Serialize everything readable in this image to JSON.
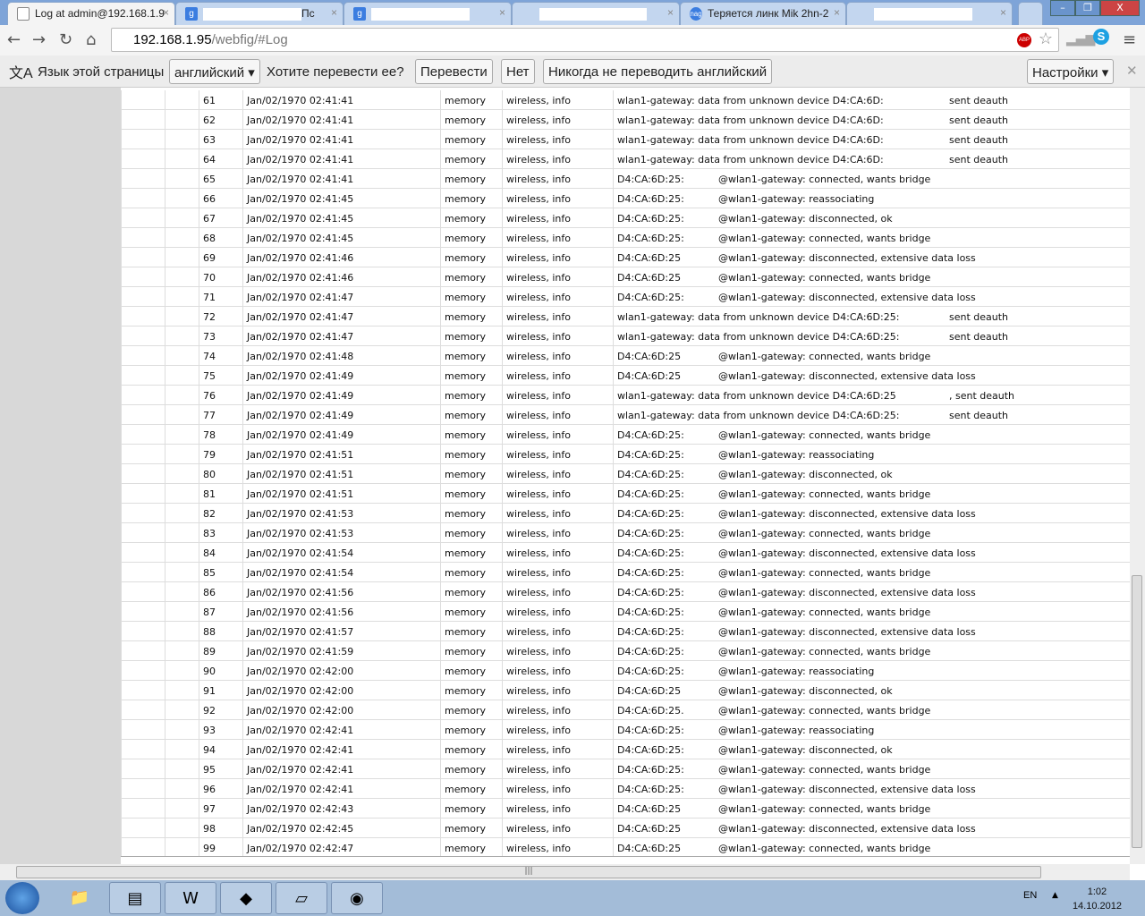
{
  "browser": {
    "tabs": [
      {
        "title": "Log at admin@192.168.1.9",
        "favicon": "page-icon",
        "active": true
      },
      {
        "title": "Пс",
        "favicon": "google-icon"
      },
      {
        "title": "",
        "favicon": "google-icon"
      },
      {
        "title": "",
        "favicon": ""
      },
      {
        "title": "Теряется линк Mik 2hn-2",
        "favicon": "nag-icon",
        "favicon_text": "nag"
      },
      {
        "title": "",
        "favicon": ""
      }
    ],
    "url_host": "192.168.1.95",
    "url_path": "/webfig/#Log",
    "abp_label": "ABP"
  },
  "translate": {
    "page_language_label": "Язык этой страницы",
    "language": "английский",
    "question": "Хотите перевести ее?",
    "translate_button": "Перевести",
    "no_button": "Нет",
    "never_button": "Никогда не переводить английский",
    "settings_button": "Настройки"
  },
  "log": {
    "rows": [
      [
        "61",
        "Jan/02/1970 02:41:41",
        "memory",
        "wireless, info",
        "wlan1-gateway: data from unknown device D4:CA:6D:",
        "sent deauth"
      ],
      [
        "62",
        "Jan/02/1970 02:41:41",
        "memory",
        "wireless, info",
        "wlan1-gateway: data from unknown device D4:CA:6D:",
        "sent deauth"
      ],
      [
        "63",
        "Jan/02/1970 02:41:41",
        "memory",
        "wireless, info",
        "wlan1-gateway: data from unknown device D4:CA:6D:",
        "sent deauth"
      ],
      [
        "64",
        "Jan/02/1970 02:41:41",
        "memory",
        "wireless, info",
        "wlan1-gateway: data from unknown device D4:CA:6D:",
        "sent deauth"
      ],
      [
        "65",
        "Jan/02/1970 02:41:41",
        "memory",
        "wireless, info",
        "D4:CA:6D:25:",
        "@wlan1-gateway: connected, wants bridge"
      ],
      [
        "66",
        "Jan/02/1970 02:41:45",
        "memory",
        "wireless, info",
        "D4:CA:6D:25:",
        "@wlan1-gateway: reassociating"
      ],
      [
        "67",
        "Jan/02/1970 02:41:45",
        "memory",
        "wireless, info",
        "D4:CA:6D:25:",
        "@wlan1-gateway: disconnected, ok"
      ],
      [
        "68",
        "Jan/02/1970 02:41:45",
        "memory",
        "wireless, info",
        "D4:CA:6D:25:",
        "@wlan1-gateway: connected, wants bridge"
      ],
      [
        "69",
        "Jan/02/1970 02:41:46",
        "memory",
        "wireless, info",
        "D4:CA:6D:25",
        "@wlan1-gateway: disconnected, extensive data loss"
      ],
      [
        "70",
        "Jan/02/1970 02:41:46",
        "memory",
        "wireless, info",
        "D4:CA:6D:25",
        "@wlan1-gateway: connected, wants bridge"
      ],
      [
        "71",
        "Jan/02/1970 02:41:47",
        "memory",
        "wireless, info",
        "D4:CA:6D:25:",
        "@wlan1-gateway: disconnected, extensive data loss"
      ],
      [
        "72",
        "Jan/02/1970 02:41:47",
        "memory",
        "wireless, info",
        "wlan1-gateway: data from unknown device D4:CA:6D:25:",
        "sent deauth"
      ],
      [
        "73",
        "Jan/02/1970 02:41:47",
        "memory",
        "wireless, info",
        "wlan1-gateway: data from unknown device D4:CA:6D:25:",
        "sent deauth"
      ],
      [
        "74",
        "Jan/02/1970 02:41:48",
        "memory",
        "wireless, info",
        "D4:CA:6D:25",
        "@wlan1-gateway: connected, wants bridge"
      ],
      [
        "75",
        "Jan/02/1970 02:41:49",
        "memory",
        "wireless, info",
        "D4:CA:6D:25",
        "@wlan1-gateway: disconnected, extensive data loss"
      ],
      [
        "76",
        "Jan/02/1970 02:41:49",
        "memory",
        "wireless, info",
        "wlan1-gateway: data from unknown device D4:CA:6D:25",
        ", sent deauth"
      ],
      [
        "77",
        "Jan/02/1970 02:41:49",
        "memory",
        "wireless, info",
        "wlan1-gateway: data from unknown device D4:CA:6D:25:",
        "sent deauth"
      ],
      [
        "78",
        "Jan/02/1970 02:41:49",
        "memory",
        "wireless, info",
        "D4:CA:6D:25:",
        "@wlan1-gateway: connected, wants bridge"
      ],
      [
        "79",
        "Jan/02/1970 02:41:51",
        "memory",
        "wireless, info",
        "D4:CA:6D:25:",
        "@wlan1-gateway: reassociating"
      ],
      [
        "80",
        "Jan/02/1970 02:41:51",
        "memory",
        "wireless, info",
        "D4:CA:6D:25:",
        "@wlan1-gateway: disconnected, ok"
      ],
      [
        "81",
        "Jan/02/1970 02:41:51",
        "memory",
        "wireless, info",
        "D4:CA:6D:25:",
        "@wlan1-gateway: connected, wants bridge"
      ],
      [
        "82",
        "Jan/02/1970 02:41:53",
        "memory",
        "wireless, info",
        "D4:CA:6D:25:",
        "@wlan1-gateway: disconnected, extensive data loss"
      ],
      [
        "83",
        "Jan/02/1970 02:41:53",
        "memory",
        "wireless, info",
        "D4:CA:6D:25:",
        "@wlan1-gateway: connected, wants bridge"
      ],
      [
        "84",
        "Jan/02/1970 02:41:54",
        "memory",
        "wireless, info",
        "D4:CA:6D:25:",
        "@wlan1-gateway: disconnected, extensive data loss"
      ],
      [
        "85",
        "Jan/02/1970 02:41:54",
        "memory",
        "wireless, info",
        "D4:CA:6D:25:",
        "@wlan1-gateway: connected, wants bridge"
      ],
      [
        "86",
        "Jan/02/1970 02:41:56",
        "memory",
        "wireless, info",
        "D4:CA:6D:25:",
        "@wlan1-gateway: disconnected, extensive data loss"
      ],
      [
        "87",
        "Jan/02/1970 02:41:56",
        "memory",
        "wireless, info",
        "D4:CA:6D:25:",
        "@wlan1-gateway: connected, wants bridge"
      ],
      [
        "88",
        "Jan/02/1970 02:41:57",
        "memory",
        "wireless, info",
        "D4:CA:6D:25:",
        "@wlan1-gateway: disconnected, extensive data loss"
      ],
      [
        "89",
        "Jan/02/1970 02:41:59",
        "memory",
        "wireless, info",
        "D4:CA:6D:25:",
        "@wlan1-gateway: connected, wants bridge"
      ],
      [
        "90",
        "Jan/02/1970 02:42:00",
        "memory",
        "wireless, info",
        "D4:CA:6D:25:",
        "@wlan1-gateway: reassociating"
      ],
      [
        "91",
        "Jan/02/1970 02:42:00",
        "memory",
        "wireless, info",
        "D4:CA:6D:25",
        "@wlan1-gateway: disconnected, ok"
      ],
      [
        "92",
        "Jan/02/1970 02:42:00",
        "memory",
        "wireless, info",
        "D4:CA:6D:25.",
        "@wlan1-gateway: connected, wants bridge"
      ],
      [
        "93",
        "Jan/02/1970 02:42:41",
        "memory",
        "wireless, info",
        "D4:CA:6D:25:",
        "@wlan1-gateway: reassociating"
      ],
      [
        "94",
        "Jan/02/1970 02:42:41",
        "memory",
        "wireless, info",
        "D4:CA:6D:25:",
        "@wlan1-gateway: disconnected, ok"
      ],
      [
        "95",
        "Jan/02/1970 02:42:41",
        "memory",
        "wireless, info",
        "D4:CA:6D:25:",
        "@wlan1-gateway: connected, wants bridge"
      ],
      [
        "96",
        "Jan/02/1970 02:42:41",
        "memory",
        "wireless, info",
        "D4:CA:6D:25:",
        "@wlan1-gateway: disconnected, extensive data loss"
      ],
      [
        "97",
        "Jan/02/1970 02:42:43",
        "memory",
        "wireless, info",
        "D4:CA:6D:25",
        "@wlan1-gateway: connected, wants bridge"
      ],
      [
        "98",
        "Jan/02/1970 02:42:45",
        "memory",
        "wireless, info",
        "D4:CA:6D:25",
        "@wlan1-gateway: disconnected, extensive data loss"
      ],
      [
        "99",
        "Jan/02/1970 02:42:47",
        "memory",
        "wireless, info",
        "D4:CA:6D:25",
        "@wlan1-gateway: connected, wants bridge"
      ]
    ]
  },
  "taskbar": {
    "lang": "EN",
    "time": "1:02",
    "date": "14.10.2012"
  }
}
